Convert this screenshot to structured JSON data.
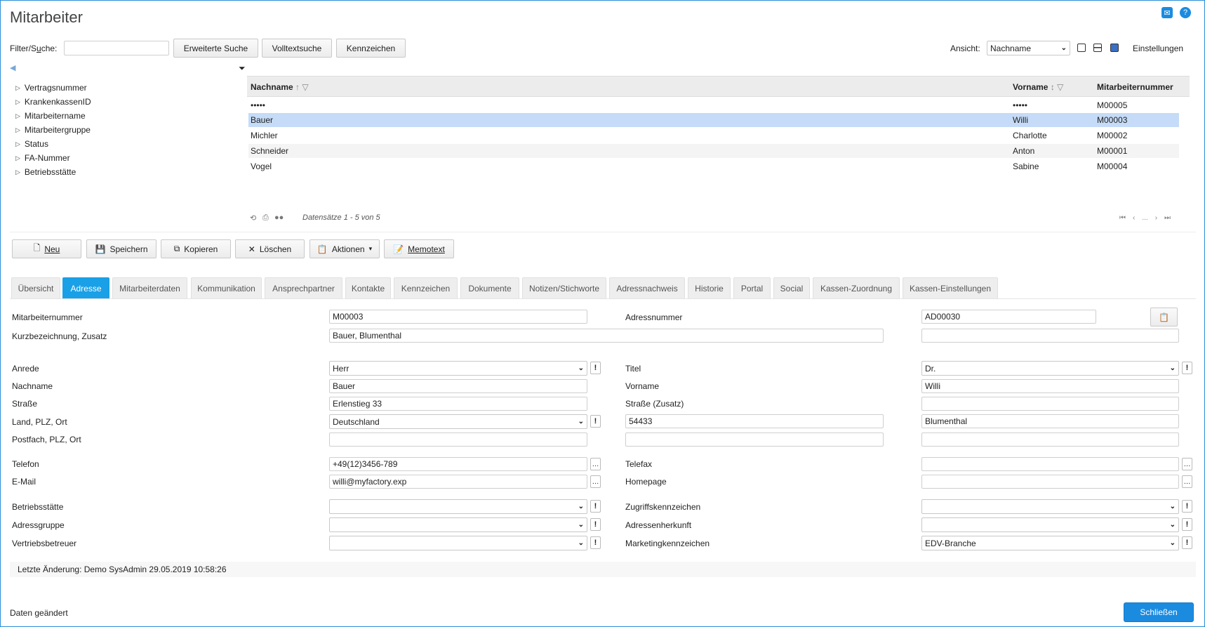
{
  "window": {
    "title": "Mitarbeiter"
  },
  "top_icons": [
    "mail-icon",
    "help-icon"
  ],
  "filter": {
    "label_pre": "Filter/S",
    "label_u": "u",
    "label_post": "che:",
    "value": "",
    "buttons": [
      "Erweiterte Suche",
      "Volltextsuche",
      "Kennzeichen"
    ]
  },
  "view": {
    "label": "Ansicht:",
    "selected": "Nachname",
    "settings_label": "Einstellungen"
  },
  "tree": {
    "items": [
      "Vertragsnummer",
      "KrankenkassenID",
      "Mitarbeitername",
      "Mitarbeitergruppe",
      "Status",
      "FA-Nummer",
      "Betriebsstätte"
    ]
  },
  "grid": {
    "columns": [
      "Nachname",
      "Vorname",
      "Mitarbeiternummer"
    ],
    "rows": [
      {
        "nachname": "•••••",
        "vorname": "•••••",
        "nummer": "M00005"
      },
      {
        "nachname": "Bauer",
        "vorname": "Willi",
        "nummer": "M00003"
      },
      {
        "nachname": "Michler",
        "vorname": "Charlotte",
        "nummer": "M00002"
      },
      {
        "nachname": "Schneider",
        "vorname": "Anton",
        "nummer": "M00001"
      },
      {
        "nachname": "Vogel",
        "vorname": "Sabine",
        "nummer": "M00004"
      }
    ],
    "records_text": "Datensätze 1 - 5 von 5",
    "pager_ellipsis": "..."
  },
  "toolbar": {
    "neu": "Neu",
    "speichern": "Speichern",
    "kopieren": "Kopieren",
    "loeschen": "Löschen",
    "aktionen": "Aktionen",
    "memotext": "Memotext"
  },
  "tabs": [
    "Übersicht",
    "Adresse",
    "Mitarbeiterdaten",
    "Kommunikation",
    "Ansprechpartner",
    "Kontakte",
    "Kennzeichen",
    "Dokumente",
    "Notizen/Stichworte",
    "Adressnachweis",
    "Historie",
    "Portal",
    "Social",
    "Kassen-Zuordnung",
    "Kassen-Einstellungen"
  ],
  "active_tab": "Adresse",
  "form": {
    "mitarbeiternummer": {
      "label": "Mitarbeiternummer",
      "value": "M00003"
    },
    "adressnummer": {
      "label": "Adressnummer",
      "value": "AD00030"
    },
    "kurzbezeichnung": {
      "label": "Kurzbezeichnung, Zusatz",
      "value": "Bauer, Blumenthal",
      "zusatz": ""
    },
    "anrede": {
      "label": "Anrede",
      "value": "Herr"
    },
    "titel": {
      "label": "Titel",
      "value": "Dr."
    },
    "nachname": {
      "label": "Nachname",
      "value": "Bauer"
    },
    "vorname": {
      "label": "Vorname",
      "value": "Willi"
    },
    "strasse": {
      "label": "Straße",
      "value": "Erlenstieg 33"
    },
    "strasse_zusatz": {
      "label": "Straße (Zusatz)",
      "value": ""
    },
    "land": {
      "label": "Land, PLZ, Ort",
      "value": "Deutschland",
      "plz": "54433",
      "ort": "Blumenthal"
    },
    "postfach": {
      "label": "Postfach, PLZ, Ort",
      "value": "",
      "plz": "",
      "ort": ""
    },
    "telefon": {
      "label": "Telefon",
      "value": "+49(12)3456-789"
    },
    "telefax": {
      "label": "Telefax",
      "value": ""
    },
    "email": {
      "label": "E-Mail",
      "value": "willi@myfactory.exp"
    },
    "homepage": {
      "label": "Homepage",
      "value": ""
    },
    "betriebsstaette": {
      "label": "Betriebsstätte",
      "value": ""
    },
    "zugriffskennzeichen": {
      "label": "Zugriffskennzeichen",
      "value": ""
    },
    "adressgruppe": {
      "label": "Adressgruppe",
      "value": ""
    },
    "adressenherkunft": {
      "label": "Adressenherkunft",
      "value": ""
    },
    "vertriebsbetreuer": {
      "label": "Vertriebsbetreuer",
      "value": ""
    },
    "marketingkennzeichen": {
      "label": "Marketingkennzeichen",
      "value": "EDV-Branche"
    }
  },
  "last_change": "Letzte Änderung: Demo SysAdmin 29.05.2019 10:58:26",
  "status_text": "Daten geändert",
  "close_button": "Schließen",
  "colors": {
    "accent": "#1b8be0",
    "selected_row": "#c5dbf7",
    "tab_active": "#1aa0e6"
  }
}
